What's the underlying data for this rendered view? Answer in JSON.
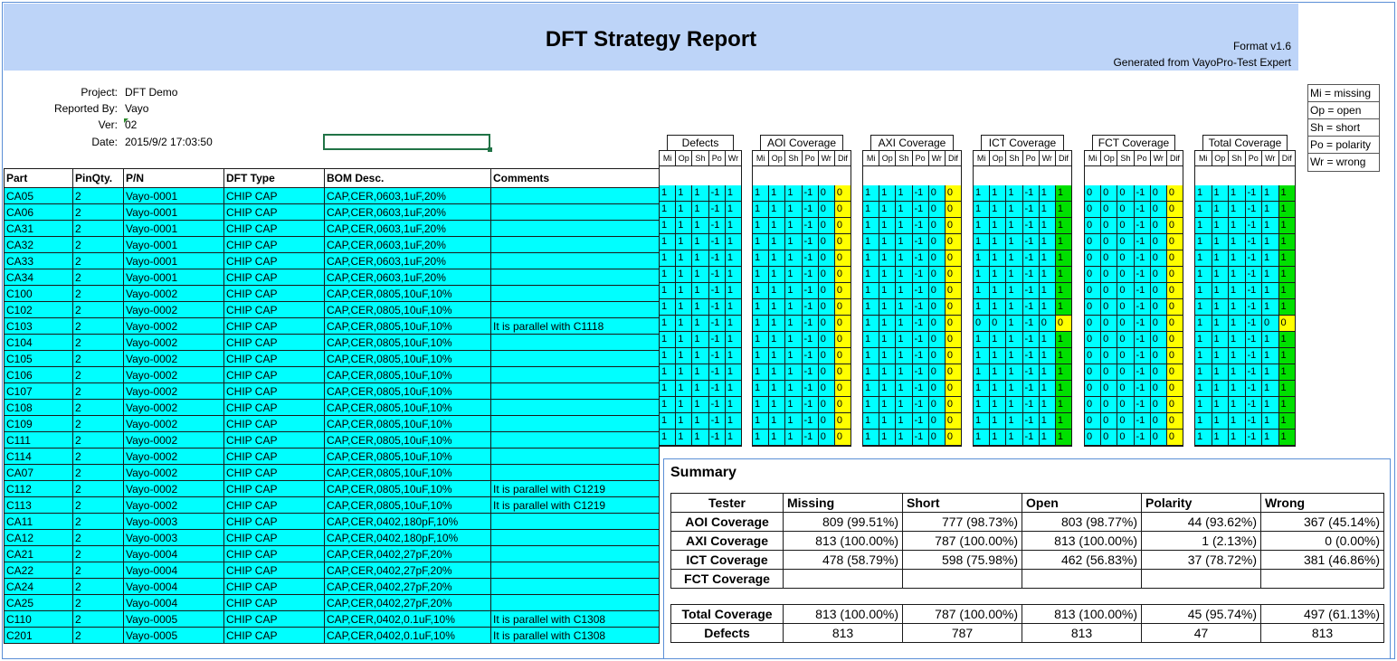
{
  "header": {
    "title": "DFT Strategy Report",
    "format": "Format v1.6",
    "generated": "Generated from VayoPro-Test Expert"
  },
  "info": {
    "project_label": "Project:",
    "project": "DFT Demo",
    "reported_by_label": "Reported By:",
    "reported_by": "Vayo",
    "ver_label": "Ver:",
    "ver": "02",
    "date_label": "Date:",
    "date": "2015/9/2 17:03:50"
  },
  "legend": [
    "Mi = missing",
    "Op = open",
    "Sh = short",
    "Po = polarity",
    "Wr = wrong"
  ],
  "columns": [
    "Part",
    "PinQty.",
    "P/N",
    "DFT Type",
    "BOM Desc.",
    "Comments"
  ],
  "rows": [
    [
      "CA05",
      "2",
      "Vayo-0001",
      "CHIP CAP",
      "CAP,CER,0603,1uF,20%",
      ""
    ],
    [
      "CA06",
      "2",
      "Vayo-0001",
      "CHIP CAP",
      "CAP,CER,0603,1uF,20%",
      ""
    ],
    [
      "CA31",
      "2",
      "Vayo-0001",
      "CHIP CAP",
      "CAP,CER,0603,1uF,20%",
      ""
    ],
    [
      "CA32",
      "2",
      "Vayo-0001",
      "CHIP CAP",
      "CAP,CER,0603,1uF,20%",
      ""
    ],
    [
      "CA33",
      "2",
      "Vayo-0001",
      "CHIP CAP",
      "CAP,CER,0603,1uF,20%",
      ""
    ],
    [
      "CA34",
      "2",
      "Vayo-0001",
      "CHIP CAP",
      "CAP,CER,0603,1uF,20%",
      ""
    ],
    [
      "C100",
      "2",
      "Vayo-0002",
      "CHIP CAP",
      "CAP,CER,0805,10uF,10%",
      ""
    ],
    [
      "C102",
      "2",
      "Vayo-0002",
      "CHIP CAP",
      "CAP,CER,0805,10uF,10%",
      ""
    ],
    [
      "C103",
      "2",
      "Vayo-0002",
      "CHIP CAP",
      "CAP,CER,0805,10uF,10%",
      "It is parallel with C1118"
    ],
    [
      "C104",
      "2",
      "Vayo-0002",
      "CHIP CAP",
      "CAP,CER,0805,10uF,10%",
      ""
    ],
    [
      "C105",
      "2",
      "Vayo-0002",
      "CHIP CAP",
      "CAP,CER,0805,10uF,10%",
      ""
    ],
    [
      "C106",
      "2",
      "Vayo-0002",
      "CHIP CAP",
      "CAP,CER,0805,10uF,10%",
      ""
    ],
    [
      "C107",
      "2",
      "Vayo-0002",
      "CHIP CAP",
      "CAP,CER,0805,10uF,10%",
      ""
    ],
    [
      "C108",
      "2",
      "Vayo-0002",
      "CHIP CAP",
      "CAP,CER,0805,10uF,10%",
      ""
    ],
    [
      "C109",
      "2",
      "Vayo-0002",
      "CHIP CAP",
      "CAP,CER,0805,10uF,10%",
      ""
    ],
    [
      "C111",
      "2",
      "Vayo-0002",
      "CHIP CAP",
      "CAP,CER,0805,10uF,10%",
      ""
    ],
    [
      "C114",
      "2",
      "Vayo-0002",
      "CHIP CAP",
      "CAP,CER,0805,10uF,10%",
      ""
    ],
    [
      "CA07",
      "2",
      "Vayo-0002",
      "CHIP CAP",
      "CAP,CER,0805,10uF,10%",
      ""
    ],
    [
      "C112",
      "2",
      "Vayo-0002",
      "CHIP CAP",
      "CAP,CER,0805,10uF,10%",
      "It is parallel with C1219"
    ],
    [
      "C113",
      "2",
      "Vayo-0002",
      "CHIP CAP",
      "CAP,CER,0805,10uF,10%",
      "It is parallel with C1219"
    ],
    [
      "CA11",
      "2",
      "Vayo-0003",
      "CHIP CAP",
      "CAP,CER,0402,180pF,10%",
      ""
    ],
    [
      "CA12",
      "2",
      "Vayo-0003",
      "CHIP CAP",
      "CAP,CER,0402,180pF,10%",
      ""
    ],
    [
      "CA21",
      "2",
      "Vayo-0004",
      "CHIP CAP",
      "CAP,CER,0402,27pF,20%",
      ""
    ],
    [
      "CA22",
      "2",
      "Vayo-0004",
      "CHIP CAP",
      "CAP,CER,0402,27pF,20%",
      ""
    ],
    [
      "CA24",
      "2",
      "Vayo-0004",
      "CHIP CAP",
      "CAP,CER,0402,27pF,20%",
      ""
    ],
    [
      "CA25",
      "2",
      "Vayo-0004",
      "CHIP CAP",
      "CAP,CER,0402,27pF,20%",
      ""
    ],
    [
      "C110",
      "2",
      "Vayo-0005",
      "CHIP CAP",
      "CAP,CER,0402,0.1uF,10%",
      "It is parallel with C1308"
    ],
    [
      "C201",
      "2",
      "Vayo-0005",
      "CHIP CAP",
      "CAP,CER,0402,0.1uF,10%",
      "It is parallel with C1308"
    ]
  ],
  "defects": {
    "title": "Defects",
    "cols": [
      "Mi",
      "Op",
      "Sh",
      "Po",
      "Wr"
    ],
    "rows": [
      [
        "1",
        "1",
        "1",
        "-1",
        "1"
      ],
      [
        "1",
        "1",
        "1",
        "-1",
        "1"
      ],
      [
        "1",
        "1",
        "1",
        "-1",
        "1"
      ],
      [
        "1",
        "1",
        "1",
        "-1",
        "1"
      ],
      [
        "1",
        "1",
        "1",
        "-1",
        "1"
      ],
      [
        "1",
        "1",
        "1",
        "-1",
        "1"
      ],
      [
        "1",
        "1",
        "1",
        "-1",
        "1"
      ],
      [
        "1",
        "1",
        "1",
        "-1",
        "1"
      ],
      [
        "1",
        "1",
        "1",
        "-1",
        "1"
      ],
      [
        "1",
        "1",
        "1",
        "-1",
        "1"
      ],
      [
        "1",
        "1",
        "1",
        "-1",
        "1"
      ],
      [
        "1",
        "1",
        "1",
        "-1",
        "1"
      ],
      [
        "1",
        "1",
        "1",
        "-1",
        "1"
      ],
      [
        "1",
        "1",
        "1",
        "-1",
        "1"
      ],
      [
        "1",
        "1",
        "1",
        "-1",
        "1"
      ],
      [
        "1",
        "1",
        "1",
        "-1",
        "1"
      ]
    ]
  },
  "coverages": [
    {
      "title": "AOI Coverage",
      "cols": [
        "Mi",
        "Op",
        "Sh",
        "Po",
        "Wr",
        "Dif"
      ],
      "rows": [
        [
          "1",
          "1",
          "1",
          "-1",
          "0",
          "0"
        ],
        [
          "1",
          "1",
          "1",
          "-1",
          "0",
          "0"
        ],
        [
          "1",
          "1",
          "1",
          "-1",
          "0",
          "0"
        ],
        [
          "1",
          "1",
          "1",
          "-1",
          "0",
          "0"
        ],
        [
          "1",
          "1",
          "1",
          "-1",
          "0",
          "0"
        ],
        [
          "1",
          "1",
          "1",
          "-1",
          "0",
          "0"
        ],
        [
          "1",
          "1",
          "1",
          "-1",
          "0",
          "0"
        ],
        [
          "1",
          "1",
          "1",
          "-1",
          "0",
          "0"
        ],
        [
          "1",
          "1",
          "1",
          "-1",
          "0",
          "0"
        ],
        [
          "1",
          "1",
          "1",
          "-1",
          "0",
          "0"
        ],
        [
          "1",
          "1",
          "1",
          "-1",
          "0",
          "0"
        ],
        [
          "1",
          "1",
          "1",
          "-1",
          "0",
          "0"
        ],
        [
          "1",
          "1",
          "1",
          "-1",
          "0",
          "0"
        ],
        [
          "1",
          "1",
          "1",
          "-1",
          "0",
          "0"
        ],
        [
          "1",
          "1",
          "1",
          "-1",
          "0",
          "0"
        ],
        [
          "1",
          "1",
          "1",
          "-1",
          "0",
          "0"
        ]
      ]
    },
    {
      "title": "AXI Coverage",
      "cols": [
        "Mi",
        "Op",
        "Sh",
        "Po",
        "Wr",
        "Dif"
      ],
      "rows": [
        [
          "1",
          "1",
          "1",
          "-1",
          "0",
          "0"
        ],
        [
          "1",
          "1",
          "1",
          "-1",
          "0",
          "0"
        ],
        [
          "1",
          "1",
          "1",
          "-1",
          "0",
          "0"
        ],
        [
          "1",
          "1",
          "1",
          "-1",
          "0",
          "0"
        ],
        [
          "1",
          "1",
          "1",
          "-1",
          "0",
          "0"
        ],
        [
          "1",
          "1",
          "1",
          "-1",
          "0",
          "0"
        ],
        [
          "1",
          "1",
          "1",
          "-1",
          "0",
          "0"
        ],
        [
          "1",
          "1",
          "1",
          "-1",
          "0",
          "0"
        ],
        [
          "1",
          "1",
          "1",
          "-1",
          "0",
          "0"
        ],
        [
          "1",
          "1",
          "1",
          "-1",
          "0",
          "0"
        ],
        [
          "1",
          "1",
          "1",
          "-1",
          "0",
          "0"
        ],
        [
          "1",
          "1",
          "1",
          "-1",
          "0",
          "0"
        ],
        [
          "1",
          "1",
          "1",
          "-1",
          "0",
          "0"
        ],
        [
          "1",
          "1",
          "1",
          "-1",
          "0",
          "0"
        ],
        [
          "1",
          "1",
          "1",
          "-1",
          "0",
          "0"
        ],
        [
          "1",
          "1",
          "1",
          "-1",
          "0",
          "0"
        ]
      ]
    },
    {
      "title": "ICT Coverage",
      "cols": [
        "Mi",
        "Op",
        "Sh",
        "Po",
        "Wr",
        "Dif"
      ],
      "rows": [
        [
          "1",
          "1",
          "1",
          "-1",
          "1",
          "1"
        ],
        [
          "1",
          "1",
          "1",
          "-1",
          "1",
          "1"
        ],
        [
          "1",
          "1",
          "1",
          "-1",
          "1",
          "1"
        ],
        [
          "1",
          "1",
          "1",
          "-1",
          "1",
          "1"
        ],
        [
          "1",
          "1",
          "1",
          "-1",
          "1",
          "1"
        ],
        [
          "1",
          "1",
          "1",
          "-1",
          "1",
          "1"
        ],
        [
          "1",
          "1",
          "1",
          "-1",
          "1",
          "1"
        ],
        [
          "1",
          "1",
          "1",
          "-1",
          "1",
          "1"
        ],
        [
          "0",
          "0",
          "1",
          "-1",
          "0",
          "0"
        ],
        [
          "1",
          "1",
          "1",
          "-1",
          "1",
          "1"
        ],
        [
          "1",
          "1",
          "1",
          "-1",
          "1",
          "1"
        ],
        [
          "1",
          "1",
          "1",
          "-1",
          "1",
          "1"
        ],
        [
          "1",
          "1",
          "1",
          "-1",
          "1",
          "1"
        ],
        [
          "1",
          "1",
          "1",
          "-1",
          "1",
          "1"
        ],
        [
          "1",
          "1",
          "1",
          "-1",
          "1",
          "1"
        ],
        [
          "1",
          "1",
          "1",
          "-1",
          "1",
          "1"
        ]
      ]
    },
    {
      "title": "FCT Coverage",
      "cols": [
        "Mi",
        "Op",
        "Sh",
        "Po",
        "Wr",
        "Dif"
      ],
      "rows": [
        [
          "0",
          "0",
          "0",
          "-1",
          "0",
          "0"
        ],
        [
          "0",
          "0",
          "0",
          "-1",
          "0",
          "0"
        ],
        [
          "0",
          "0",
          "0",
          "-1",
          "0",
          "0"
        ],
        [
          "0",
          "0",
          "0",
          "-1",
          "0",
          "0"
        ],
        [
          "0",
          "0",
          "0",
          "-1",
          "0",
          "0"
        ],
        [
          "0",
          "0",
          "0",
          "-1",
          "0",
          "0"
        ],
        [
          "0",
          "0",
          "0",
          "-1",
          "0",
          "0"
        ],
        [
          "0",
          "0",
          "0",
          "-1",
          "0",
          "0"
        ],
        [
          "0",
          "0",
          "0",
          "-1",
          "0",
          "0"
        ],
        [
          "0",
          "0",
          "0",
          "-1",
          "0",
          "0"
        ],
        [
          "0",
          "0",
          "0",
          "-1",
          "0",
          "0"
        ],
        [
          "0",
          "0",
          "0",
          "-1",
          "0",
          "0"
        ],
        [
          "0",
          "0",
          "0",
          "-1",
          "0",
          "0"
        ],
        [
          "0",
          "0",
          "0",
          "-1",
          "0",
          "0"
        ],
        [
          "0",
          "0",
          "0",
          "-1",
          "0",
          "0"
        ],
        [
          "0",
          "0",
          "0",
          "-1",
          "0",
          "0"
        ]
      ]
    },
    {
      "title": "Total Coverage",
      "cols": [
        "Mi",
        "Op",
        "Sh",
        "Po",
        "Wr",
        "Dif"
      ],
      "rows": [
        [
          "1",
          "1",
          "1",
          "-1",
          "1",
          "1"
        ],
        [
          "1",
          "1",
          "1",
          "-1",
          "1",
          "1"
        ],
        [
          "1",
          "1",
          "1",
          "-1",
          "1",
          "1"
        ],
        [
          "1",
          "1",
          "1",
          "-1",
          "1",
          "1"
        ],
        [
          "1",
          "1",
          "1",
          "-1",
          "1",
          "1"
        ],
        [
          "1",
          "1",
          "1",
          "-1",
          "1",
          "1"
        ],
        [
          "1",
          "1",
          "1",
          "-1",
          "1",
          "1"
        ],
        [
          "1",
          "1",
          "1",
          "-1",
          "1",
          "1"
        ],
        [
          "1",
          "1",
          "1",
          "-1",
          "0",
          "0"
        ],
        [
          "1",
          "1",
          "1",
          "-1",
          "1",
          "1"
        ],
        [
          "1",
          "1",
          "1",
          "-1",
          "1",
          "1"
        ],
        [
          "1",
          "1",
          "1",
          "-1",
          "1",
          "1"
        ],
        [
          "1",
          "1",
          "1",
          "-1",
          "1",
          "1"
        ],
        [
          "1",
          "1",
          "1",
          "-1",
          "1",
          "1"
        ],
        [
          "1",
          "1",
          "1",
          "-1",
          "1",
          "1"
        ],
        [
          "1",
          "1",
          "1",
          "-1",
          "1",
          "1"
        ]
      ]
    }
  ],
  "summary": {
    "title": "Summary",
    "headers": [
      "Tester",
      "Missing",
      "Short",
      "Open",
      "Polarity",
      "Wrong"
    ],
    "rows": [
      [
        "AOI Coverage",
        "809 (99.51%)",
        "777 (98.73%)",
        "803 (98.77%)",
        "44 (93.62%)",
        "367 (45.14%)"
      ],
      [
        "AXI Coverage",
        "813 (100.00%)",
        "787 (100.00%)",
        "813 (100.00%)",
        "1 (2.13%)",
        "0 (0.00%)"
      ],
      [
        "ICT Coverage",
        "478 (58.79%)",
        "598 (75.98%)",
        "462 (56.83%)",
        "37 (78.72%)",
        "381 (46.86%)"
      ],
      [
        "FCT Coverage",
        "",
        "",
        "",
        "",
        ""
      ]
    ],
    "total": [
      "Total Coverage",
      "813 (100.00%)",
      "787 (100.00%)",
      "813 (100.00%)",
      "45 (95.74%)",
      "497 (61.13%)"
    ],
    "defects": [
      "Defects",
      "813",
      "787",
      "813",
      "47",
      "813"
    ]
  },
  "colors": {
    "header_band": "#bdd4f8",
    "cell_cyan": "#00ffff",
    "dif_zero": "#ffff00",
    "dif_one": "#00e000"
  }
}
